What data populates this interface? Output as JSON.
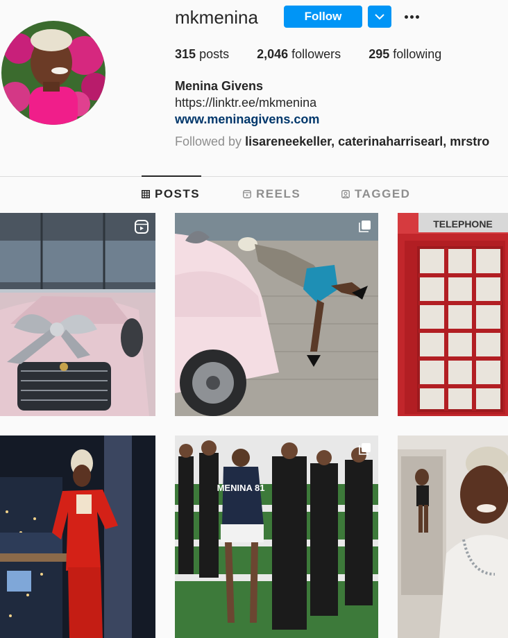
{
  "profile": {
    "username": "mkmenina",
    "follow_label": "Follow",
    "full_name": "Menina Givens",
    "link": "https://linktr.ee/mkmenina",
    "website": "www.meninagivens.com",
    "followed_by_prefix": "Followed by",
    "followed_by_names": "lisareneekeller, caterinaharrisearl, mrstro"
  },
  "stats": {
    "posts_count": "315",
    "posts_label": "posts",
    "followers_count": "2,046",
    "followers_label": "followers",
    "following_count": "295",
    "following_label": "following"
  },
  "tabs": [
    {
      "label": "POSTS",
      "icon": "grid-icon",
      "active": true
    },
    {
      "label": "REELS",
      "icon": "reels-icon",
      "active": false
    },
    {
      "label": "TAGGED",
      "icon": "tagged-icon",
      "active": false
    }
  ],
  "posts": [
    {
      "subject": "pink SUV with silver bow",
      "badge": "reel-icon"
    },
    {
      "subject": "woman kissing pink SUV",
      "badge": "carousel-icon"
    },
    {
      "subject": "red telephone box",
      "sign": "TELEPHONE",
      "badge": ""
    },
    {
      "subject": "woman in red suit by night city window",
      "badge": ""
    },
    {
      "subject": "group on football field",
      "jersey": "MENINA 81",
      "badge": "carousel-icon"
    },
    {
      "subject": "selfie in mirror",
      "badge": ""
    }
  ],
  "colors": {
    "accent": "#0095f6",
    "link": "#00376b",
    "muted": "#8e8e8e",
    "text": "#262626"
  }
}
